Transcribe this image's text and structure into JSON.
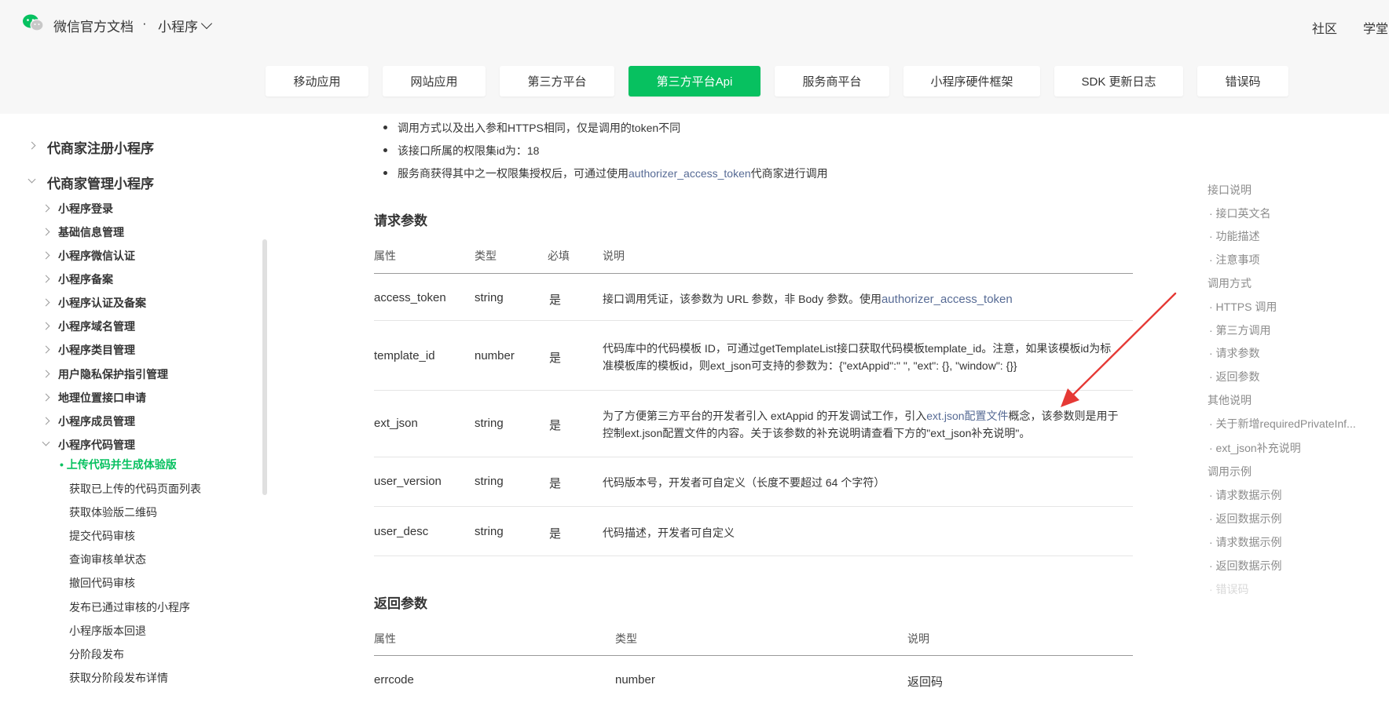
{
  "header": {
    "brand": "微信官方文档",
    "separator": "·",
    "section": "小程序",
    "nav": [
      "社区",
      "学堂"
    ]
  },
  "tabs": [
    {
      "label": "移动应用",
      "active": false
    },
    {
      "label": "网站应用",
      "active": false
    },
    {
      "label": "第三方平台",
      "active": false
    },
    {
      "label": "第三方平台Api",
      "active": true
    },
    {
      "label": "服务商平台",
      "active": false
    },
    {
      "label": "小程序硬件框架",
      "active": false
    },
    {
      "label": "SDK 更新日志",
      "active": false
    },
    {
      "label": "错误码",
      "active": false
    }
  ],
  "sidebar": {
    "l1": [
      "代商家注册小程序",
      "代商家管理小程序"
    ],
    "l2": [
      "小程序登录",
      "基础信息管理",
      "小程序微信认证",
      "小程序备案",
      "小程序认证及备案",
      "小程序域名管理",
      "小程序类目管理",
      "用户隐私保护指引管理",
      "地理位置接口申请",
      "小程序成员管理",
      "小程序代码管理"
    ],
    "l3_active": "上传代码并生成体验版",
    "l3": [
      "获取已上传的代码页面列表",
      "获取体验版二维码",
      "提交代码审核",
      "查询审核单状态",
      "撤回代码审核",
      "发布已通过审核的小程序",
      "小程序版本回退",
      "分阶段发布",
      "获取分阶段发布详情"
    ]
  },
  "notes": {
    "bullet1": "调用方式以及出入参和HTTPS相同，仅是调用的token不同",
    "bullet2": "该接口所属的权限集id为：18",
    "bullet3_pre": "服务商获得其中之一权限集授权后，可通过使用",
    "bullet3_link": "authorizer_access_token",
    "bullet3_post": "代商家进行调用"
  },
  "request": {
    "title": "请求参数",
    "headers": [
      "属性",
      "类型",
      "必填",
      "说明"
    ],
    "rows": [
      {
        "name": "access_token",
        "type": "string",
        "required": "是",
        "desc_pre": "接口调用凭证，该参数为 URL 参数，非 Body 参数。使用",
        "desc_link": "authorizer_access_token",
        "desc_post": ""
      },
      {
        "name": "template_id",
        "type": "number",
        "required": "是",
        "desc_line1": "代码库中的代码模板 ID，可通过getTemplateList接口获取代码模板template_id。注意，如果该模板id为标",
        "desc_line2": "准模板库的模板id，则ext_json可支持的参数为：{\"extAppid\":\" \", \"ext\": {}, \"window\": {}}"
      },
      {
        "name": "ext_json",
        "type": "string",
        "required": "是",
        "desc_pre": "为了方便第三方平台的开发者引入 extAppid 的开发调试工作，引入",
        "desc_link": "ext.json配置文件",
        "desc_post": "概念，该参数则是用于",
        "desc_line2": "控制ext.json配置文件的内容。关于该参数的补充说明请查看下方的\"ext_json补充说明\"。"
      },
      {
        "name": "user_version",
        "type": "string",
        "required": "是",
        "desc": "代码版本号，开发者可自定义（长度不要超过 64 个字符）"
      },
      {
        "name": "user_desc",
        "type": "string",
        "required": "是",
        "desc": "代码描述，开发者可自定义"
      }
    ]
  },
  "response": {
    "title": "返回参数",
    "headers": [
      "属性",
      "类型",
      "说明"
    ],
    "rows": [
      {
        "name": "errcode",
        "type": "number",
        "desc": "返回码"
      }
    ]
  },
  "toc": [
    {
      "label": "接口说明",
      "sub": false
    },
    {
      "label": "· 接口英文名",
      "sub": true
    },
    {
      "label": "· 功能描述",
      "sub": true
    },
    {
      "label": "· 注意事项",
      "sub": true
    },
    {
      "label": "调用方式",
      "sub": false
    },
    {
      "label": "· HTTPS 调用",
      "sub": true
    },
    {
      "label": "· 第三方调用",
      "sub": true
    },
    {
      "label": "· 请求参数",
      "sub": true
    },
    {
      "label": "· 返回参数",
      "sub": true
    },
    {
      "label": "其他说明",
      "sub": false
    },
    {
      "label": "· 关于新增requiredPrivateInf...",
      "sub": true
    },
    {
      "label": "· ext_json补充说明",
      "sub": true
    },
    {
      "label": "调用示例",
      "sub": false
    },
    {
      "label": "· 请求数据示例",
      "sub": true
    },
    {
      "label": "· 返回数据示例",
      "sub": true
    },
    {
      "label": "· 请求数据示例",
      "sub": true
    },
    {
      "label": "· 返回数据示例",
      "sub": true
    },
    {
      "label": "· 错误码",
      "sub": true
    }
  ],
  "colors": {
    "accent": "#07c160",
    "link": "#576b95",
    "annotation": "#e53935"
  }
}
